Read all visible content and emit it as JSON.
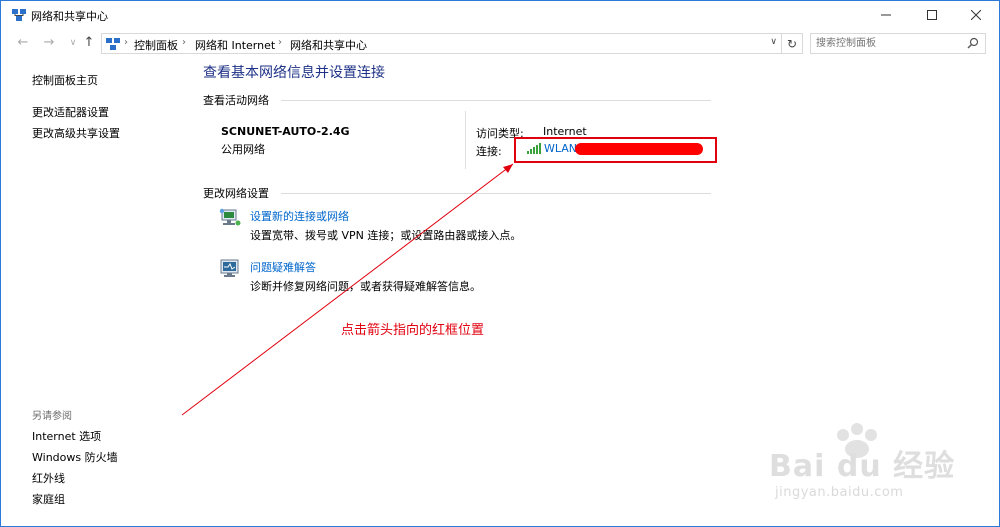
{
  "window": {
    "title": "网络和共享中心",
    "controls": {
      "minimize": "—",
      "maximize": "☐",
      "close": "✕"
    }
  },
  "address_bar": {
    "breadcrumbs": [
      "控制面板",
      "网络和 Internet",
      "网络和共享中心"
    ],
    "search_placeholder": "搜索控制面板"
  },
  "left_pane": {
    "links": [
      "控制面板主页",
      "更改适配器设置",
      "更改高级共享设置"
    ],
    "see_also_header": "另请参阅",
    "see_also": [
      "Internet 选项",
      "Windows 防火墙",
      "红外线",
      "家庭组"
    ]
  },
  "main": {
    "title": "查看基本网络信息并设置连接",
    "active_networks_header": "查看活动网络",
    "network": {
      "name": "SCNUNET-AUTO-2.4G",
      "type": "公用网络",
      "access_type_label": "访问类型:",
      "access_type_value": "Internet",
      "connection_label": "连接:",
      "connection_value": "WLAN"
    },
    "change_settings_header": "更改网络设置",
    "tasks": [
      {
        "link": "设置新的连接或网络",
        "desc": "设置宽带、拨号或 VPN 连接；或设置路由器或接入点。",
        "icon": "network-setup-icon"
      },
      {
        "link": "问题疑难解答",
        "desc": "诊断并修复网络问题，或者获得疑难解答信息。",
        "icon": "troubleshoot-icon"
      }
    ]
  },
  "annotation": {
    "text": "点击箭头指向的红框位置",
    "color": "#e0000e"
  },
  "watermark": {
    "logo": "Bai du 经验",
    "url": "jingyan.baidu.com"
  },
  "colors": {
    "title_blue": "#1e3287",
    "link_blue": "#0066cc",
    "annotation_red": "#e0000e",
    "border_blue": "#2b79d8"
  }
}
